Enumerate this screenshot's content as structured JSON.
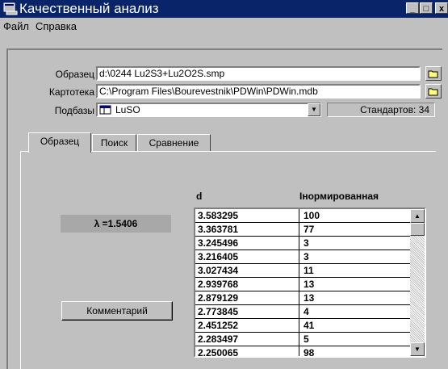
{
  "window": {
    "title": "Качественный анализ",
    "minimize": "_",
    "maximize": "□",
    "close": "x"
  },
  "menu": {
    "items": [
      "Файл",
      "Справка"
    ]
  },
  "form": {
    "sample_label": "Образец",
    "sample_value": "d:\\0244 Lu2S3+Lu2O2S.smp",
    "catalog_label": "Картотека",
    "catalog_value": "C:\\Program Files\\Bourevestnik\\PDWin\\PDWin.mdb",
    "subbase_label": "Подбазы",
    "subbase_value": "LuSO",
    "standards_count": "Стандартов: 34"
  },
  "tabs": [
    "Образец",
    "Поиск",
    "Сравнение"
  ],
  "wavelength": "λ =1.5406",
  "comment_button": "Комментарий",
  "table": {
    "columns": [
      "d",
      "Iнормированная"
    ],
    "rows": [
      [
        "3.583295",
        "100"
      ],
      [
        "3.363781",
        "77"
      ],
      [
        "3.245496",
        "3"
      ],
      [
        "3.216405",
        "3"
      ],
      [
        "3.027434",
        "11"
      ],
      [
        "2.939768",
        "13"
      ],
      [
        "2.879129",
        "13"
      ],
      [
        "2.773845",
        "4"
      ],
      [
        "2.451252",
        "41"
      ],
      [
        "2.283497",
        "5"
      ],
      [
        "2.250065",
        "98"
      ]
    ]
  }
}
